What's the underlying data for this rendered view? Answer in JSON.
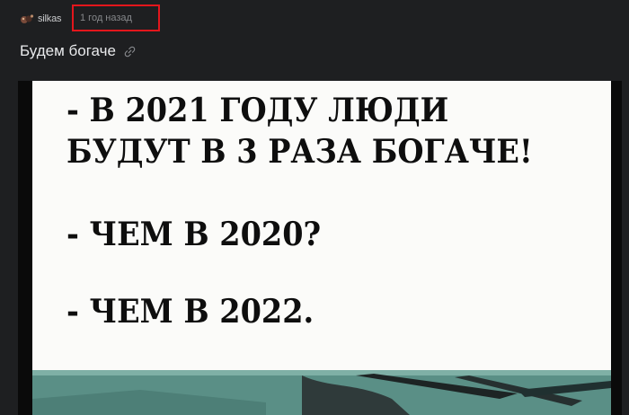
{
  "post": {
    "author": "silkas",
    "time": "1 год назад",
    "title": "Будем богаче",
    "link_icon": "link-icon",
    "avatar_icon": "avatar"
  },
  "meme": {
    "lines": [
      "- В 2021 ГОДУ ЛЮДИ",
      "БУДУТ В 3 РАЗА БОГАЧЕ!",
      "- ЧЕМ В 2020?",
      "- ЧЕМ В 2022."
    ]
  },
  "colors": {
    "background": "#1e1f21",
    "highlight_border": "#e3161c",
    "title_text": "#e9eaec",
    "meta_text": "#86888b"
  }
}
